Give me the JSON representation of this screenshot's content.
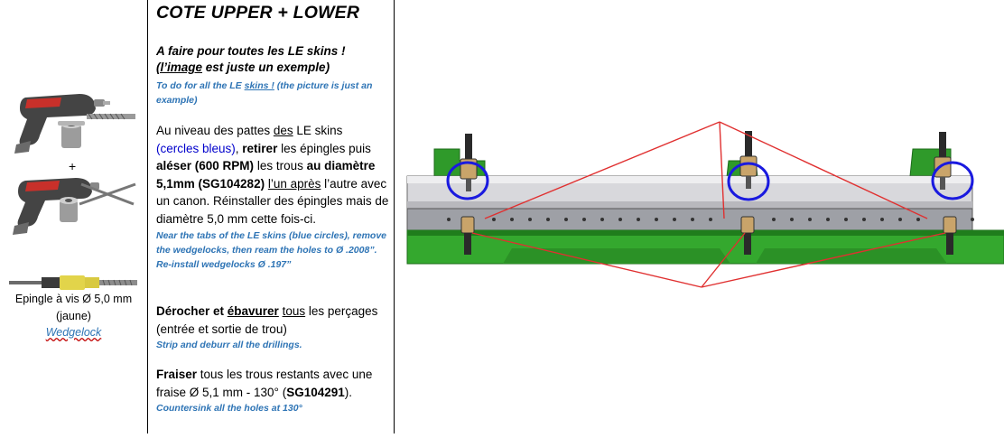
{
  "left": {
    "plus": "+",
    "pin_label_line1": "Epingle à vis Ø 5,0 mm",
    "pin_label_line2": "(jaune)",
    "pin_label_link": "Wedgelock"
  },
  "middle": {
    "title": "COTE UPPER + LOWER",
    "fr_note_line1": "A faire pour toutes les LE skins !",
    "fr_note_line2_u": "(l’image",
    "fr_note_line2_rest": " est juste un exemple)",
    "en_note_a": "To do for all the LE ",
    "en_note_u": "skins !",
    "en_note_b": " (the picture is just an example)",
    "p1": {
      "t1": "Au niveau des pattes ",
      "t2_u": "des",
      "t3": " LE skins",
      "t4_blue": "(cercles bleus)",
      "t5": ", ",
      "t6_b": "retirer",
      "t7": " les épingles puis ",
      "t8_b": "aléser (600 RPM)",
      "t9": " les trous ",
      "t10_b": "au diamètre 5,1mm (SG104282)",
      "t11": " ",
      "t12_u": "l’un après",
      "t13": " l’autre avec un canon. Réinstaller des épingles mais de diamètre 5,0 mm cette fois-ci.",
      "en": "Near the tabs of the LE skins (blue circles), remove the wedgelocks, then ream the holes to Ø .2008”. Re-install wedgelocks Ø .197”"
    },
    "p2": {
      "t1_b": "Dérocher et ",
      "t2_bu": "ébavurer",
      "t3": "  ",
      "t4_u": "tous",
      "t5": " les perçages (entrée et sortie de trou)",
      "en": "Strip and deburr all the drillings."
    },
    "p3": {
      "t1_b": "Fraiser",
      "t2": " tous les trous restants avec une fraise Ø 5,1 mm - 130° (",
      "t3_b": "SG104291",
      "t4": ").",
      "en": "Countersink all the holes at 130°"
    }
  },
  "colors": {
    "green": "#2f9a2a",
    "dark_green": "#1c6b1a",
    "blue_circle": "#1a1adf",
    "red_line": "#e03030",
    "en_text": "#2e74b5"
  }
}
